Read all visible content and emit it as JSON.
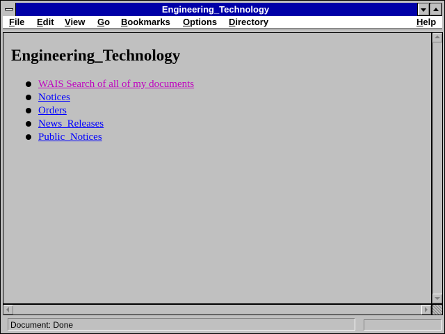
{
  "window": {
    "title": "Engineering_Technology"
  },
  "menu": [
    {
      "label": "File",
      "key": "F",
      "rest": "ile"
    },
    {
      "label": "Edit",
      "key": "E",
      "rest": "dit"
    },
    {
      "label": "View",
      "key": "V",
      "rest": "iew"
    },
    {
      "label": "Go",
      "key": "G",
      "rest": "o"
    },
    {
      "label": "Bookmarks",
      "key": "B",
      "rest": "ookmarks"
    },
    {
      "label": "Options",
      "key": "O",
      "rest": "ptions"
    },
    {
      "label": "Directory",
      "key": "D",
      "rest": "irectory"
    },
    {
      "label": "Help",
      "key": "H",
      "rest": "elp"
    }
  ],
  "page": {
    "heading": "Engineering_Technology",
    "links": [
      {
        "text": "WAIS Search of all of my documents",
        "visited": true
      },
      {
        "text": "Notices",
        "visited": false
      },
      {
        "text": "Orders",
        "visited": false
      },
      {
        "text": "News_Releases",
        "visited": false
      },
      {
        "text": "Public_Notices",
        "visited": false
      }
    ]
  },
  "status": {
    "text": "Document: Done",
    "progress": 0
  },
  "colors": {
    "title_bar": "#0000a8",
    "link": "#0000ff",
    "visited_link": "#c000c0",
    "background": "#c0c0c0"
  },
  "icons": {
    "system_menu": "system-menu-icon",
    "minimize": "minimize-icon",
    "maximize": "maximize-icon",
    "scroll_up": "arrow-up-icon",
    "scroll_down": "arrow-down-icon",
    "scroll_left": "arrow-left-icon",
    "scroll_right": "arrow-right-icon"
  }
}
